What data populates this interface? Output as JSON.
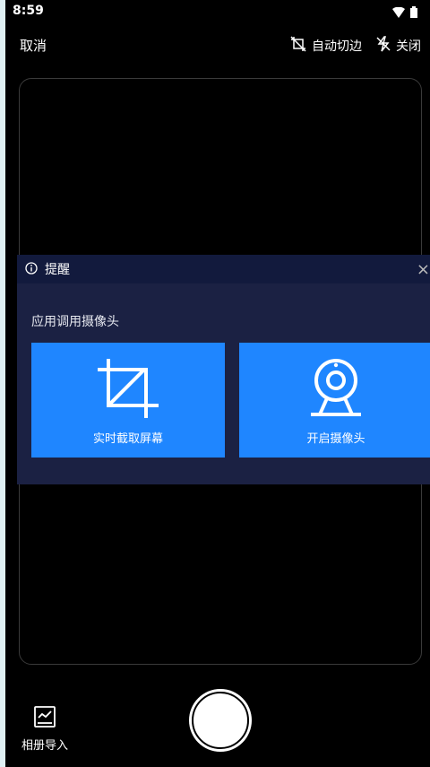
{
  "status_bar": {
    "time": "8:59",
    "icons": [
      "wifi-icon",
      "battery-icon"
    ]
  },
  "top_bar": {
    "cancel_label": "取消",
    "auto_crop_label": "自动切边",
    "flash_label": "关闭"
  },
  "dialog": {
    "title": "提醒",
    "message": "应用调用摄像头",
    "options": [
      {
        "label": "实时截取屏幕",
        "icon": "crop-icon"
      },
      {
        "label": "开启摄像头",
        "icon": "webcam-icon"
      }
    ]
  },
  "bottom_bar": {
    "album_label": "相册导入"
  },
  "colors": {
    "background": "#000000",
    "dialog_bg": "#1b2143",
    "dialog_header_bg": "#121a3d",
    "option_button": "#1f86ff"
  }
}
